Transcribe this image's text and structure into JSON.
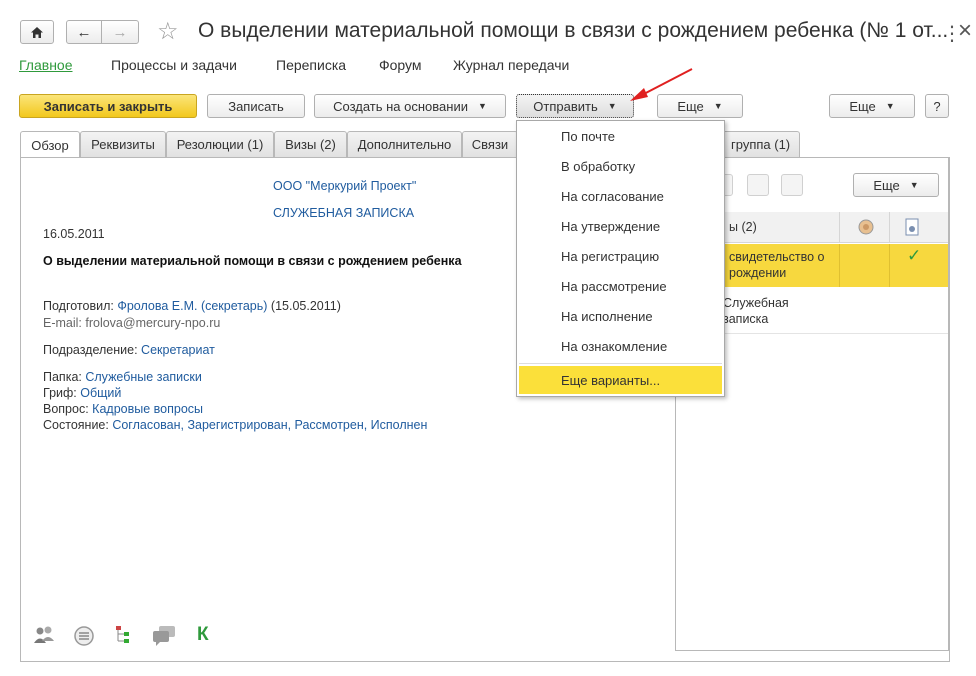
{
  "window": {
    "title": "О выделении материальной помощи в связи с рождением ребенка (№ 1 от...",
    "menu_icon": "⋮",
    "close_icon": "×"
  },
  "topnav": [
    "Главное",
    "Процессы и задачи",
    "Переписка",
    "Форум",
    "Журнал передачи"
  ],
  "toolbar": {
    "save_close": "Записать и закрыть",
    "save": "Записать",
    "create_based": "Создать на основании",
    "send": "Отправить",
    "more1": "Еще",
    "more2": "Еще",
    "help": "?"
  },
  "tabs": [
    "Обзор",
    "Реквизиты",
    "Резолюции (1)",
    "Визы (2)",
    "Дополнительно",
    "Связи",
    "группа (1)"
  ],
  "document": {
    "org": "ООО \"Меркурий Проект\"",
    "type": "СЛУЖЕБНАЯ ЗАПИСКА",
    "date": "16.05.2011",
    "subject": "О выделении материальной помощи в связи с рождением ребенка",
    "prepared_label": "Подготовил: ",
    "prepared_value": "Фролова Е.М. (секретарь)",
    "prepared_date": " (15.05.2011)",
    "email": "E-mail: frolova@mercury-npo.ru",
    "dept_label": "Подразделение: ",
    "dept_value": "Секретариат",
    "folder_label": "Папка: ",
    "folder_value": "Служебные записки",
    "stamp_label": "Гриф: ",
    "stamp_value": "Общий",
    "question_label": "Вопрос: ",
    "question_value": "Кадровые вопросы",
    "state_label": "Состояние: ",
    "state_value": "Согласован, Зарегистрирован, Рассмотрен, Исполнен"
  },
  "send_menu": {
    "items": [
      "По почте",
      "В обработку",
      "На согласование",
      "На утверждение",
      "На регистрацию",
      "На рассмотрение",
      "На исполнение",
      "На ознакомление"
    ],
    "more": "Еще варианты..."
  },
  "right_panel": {
    "more": "Еще",
    "grid_header": "ы (2)",
    "rows": [
      {
        "line1": "свидетельство о",
        "line2": "рождении",
        "check": "✓"
      },
      {
        "line1": "Служебная",
        "line2": "записка"
      }
    ]
  },
  "bottom_icons": [
    "users-icon",
    "circle-list-icon",
    "tree-icon",
    "chat-icon",
    "k-letter-icon"
  ],
  "bottom_k": "К",
  "colors": {
    "accent_yellow": "#f7d83e",
    "link": "#1f5b9e",
    "nav_active": "#2f9a3c",
    "arrow": "#e02020"
  }
}
